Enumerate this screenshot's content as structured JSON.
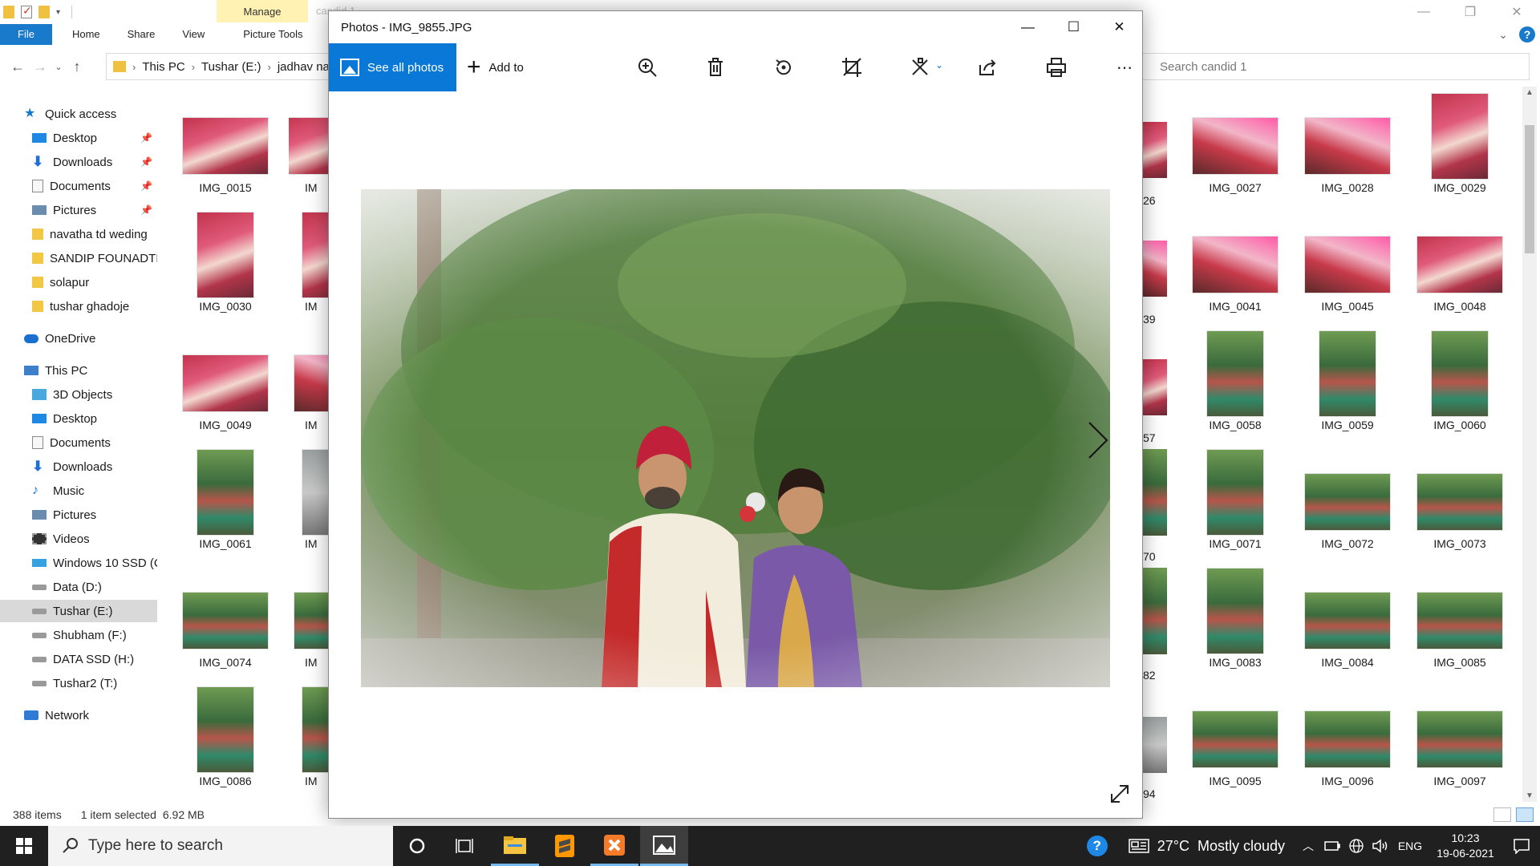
{
  "explorer": {
    "ribbon": {
      "manage": "Manage",
      "ghost_title": "candid 1",
      "tabs": [
        "File",
        "Home",
        "Share",
        "View",
        "Picture Tools"
      ]
    },
    "breadcrumb": [
      "This PC",
      "Tushar (E:)",
      "jadhav na"
    ],
    "search_placeholder": "Search candid 1",
    "nav": {
      "quick_access": "Quick access",
      "quick_items": [
        "Desktop",
        "Downloads",
        "Documents",
        "Pictures",
        "navatha td weding",
        "SANDIP FOUNADTI(",
        "solapur",
        "tushar ghadoje"
      ],
      "onedrive": "OneDrive",
      "this_pc": "This PC",
      "pc_items": [
        "3D Objects",
        "Desktop",
        "Documents",
        "Downloads",
        "Music",
        "Pictures",
        "Videos",
        "Windows 10 SSD (C",
        "Data (D:)",
        "Tushar (E:)",
        "Shubham (F:)",
        "DATA SSD (H:)",
        "Tushar2 (T:)"
      ],
      "network": "Network"
    },
    "thumbnails_left": [
      "IMG_0015",
      "IMG_0030",
      "IMG_0049",
      "IMG_0061",
      "IMG_0074",
      "IMG_0086"
    ],
    "thumbnails_mid_partial": [
      "IM",
      "IM",
      "IM",
      "IM",
      "IM",
      "IM"
    ],
    "thumbnails_right_partial": [
      "26",
      "39",
      "57",
      "70",
      "82",
      "94"
    ],
    "thumbnails_right": [
      [
        "IMG_0027",
        "IMG_0028",
        "IMG_0029"
      ],
      [
        "IMG_0041",
        "IMG_0045",
        "IMG_0048"
      ],
      [
        "IMG_0058",
        "IMG_0059",
        "IMG_0060"
      ],
      [
        "IMG_0071",
        "IMG_0072",
        "IMG_0073"
      ],
      [
        "IMG_0083",
        "IMG_0084",
        "IMG_0085"
      ],
      [
        "IMG_0095",
        "IMG_0096",
        "IMG_0097"
      ]
    ],
    "status": {
      "items": "388 items",
      "selected": "1 item selected",
      "size": "6.92 MB"
    }
  },
  "photos": {
    "title": "Photos - IMG_9855.JPG",
    "see_all": "See all photos",
    "add_to": "Add to",
    "accent": "#0a78d7"
  },
  "taskbar": {
    "search_placeholder": "Type here to search",
    "weather": "27°C  Mostly cloudy",
    "lang": "ENG",
    "time": "10:23",
    "date": "19-06-2021"
  }
}
